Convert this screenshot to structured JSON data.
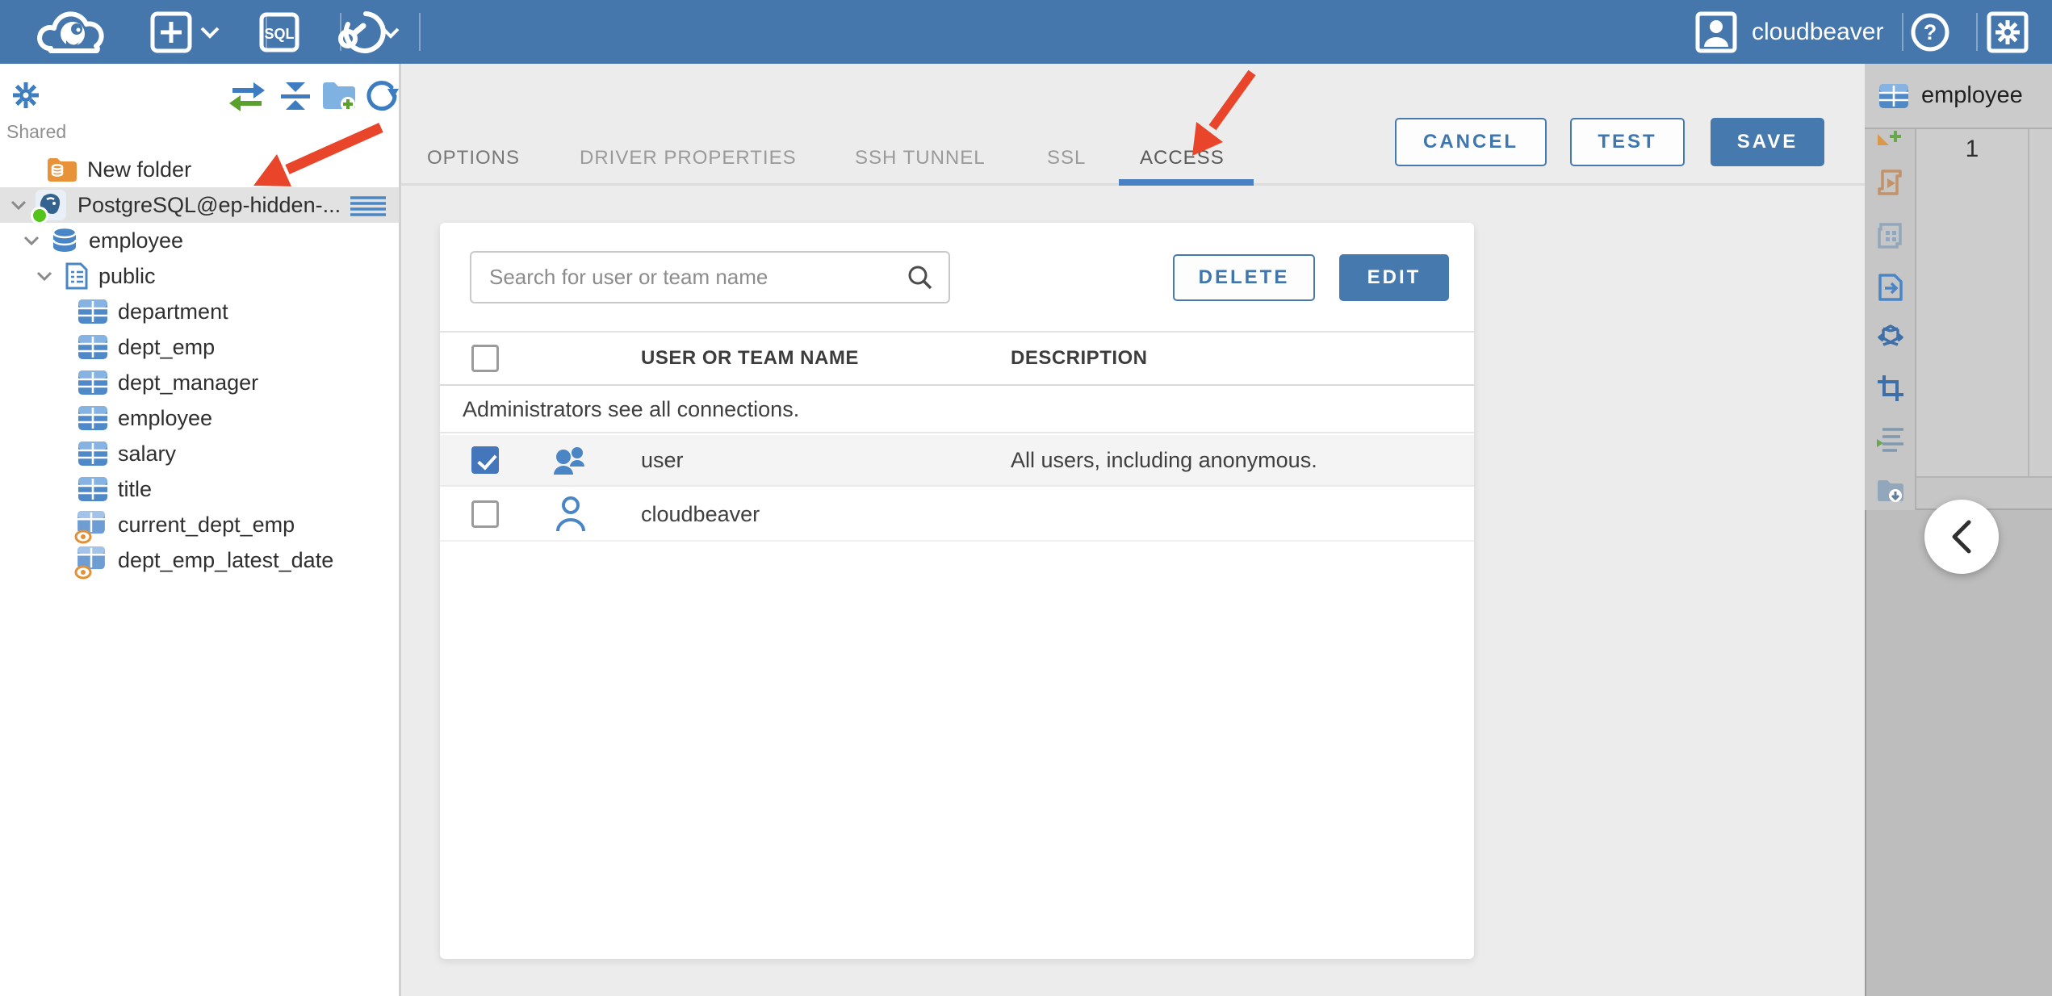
{
  "header": {
    "app_logo": "cloudbeaver-dog-cloud-logo",
    "sql_label": "SQL",
    "user_label": "cloudbeaver",
    "help_label": "?"
  },
  "sidebar": {
    "section_label": "Shared",
    "tree": [
      {
        "label": "New folder",
        "icon": "folder-database-icon"
      },
      {
        "label": "PostgreSQL@ep-hidden-...",
        "icon": "postgresql-icon",
        "selected": true,
        "status": "connected-green-dot"
      },
      {
        "label": "employee",
        "icon": "database-icon"
      },
      {
        "label": "public",
        "icon": "schema-icon"
      },
      {
        "label": "department",
        "icon": "table-icon"
      },
      {
        "label": "dept_emp",
        "icon": "table-icon"
      },
      {
        "label": "dept_manager",
        "icon": "table-icon"
      },
      {
        "label": "employee",
        "icon": "table-icon"
      },
      {
        "label": "salary",
        "icon": "table-icon"
      },
      {
        "label": "title",
        "icon": "table-icon"
      },
      {
        "label": "current_dept_emp",
        "icon": "view-icon"
      },
      {
        "label": "dept_emp_latest_date",
        "icon": "view-icon"
      }
    ]
  },
  "main": {
    "tabs": [
      {
        "label": "OPTIONS",
        "active": false
      },
      {
        "label": "DRIVER PROPERTIES",
        "active": false
      },
      {
        "label": "SSH TUNNEL",
        "active": false
      },
      {
        "label": "SSL",
        "active": false
      },
      {
        "label": "ACCESS",
        "active": true
      }
    ],
    "actions": {
      "cancel": "CANCEL",
      "test": "TEST",
      "save": "SAVE"
    },
    "access": {
      "search_placeholder": "Search for user or team name",
      "delete_label": "DELETE",
      "edit_label": "EDIT",
      "columns": [
        "USER OR TEAM NAME",
        "DESCRIPTION"
      ],
      "notice": "Administrators see all connections.",
      "rows": [
        {
          "name": "user",
          "description": "All users, including anonymous.",
          "checked": true,
          "icon": "team-icon"
        },
        {
          "name": "cloudbeaver",
          "description": "",
          "checked": false,
          "icon": "user-icon"
        }
      ]
    }
  },
  "right_panel": {
    "tab_label": "employee",
    "tab_icon": "table-icon",
    "row_number": "1"
  },
  "colors": {
    "header_blue": "#4577ad",
    "accent_blue": "#4679ad",
    "tab_underline_blue": "#4a81c2",
    "checkbox_checked_blue": "#4376ba",
    "arrow_red": "#e8452b",
    "connected_green": "#52c41a"
  }
}
